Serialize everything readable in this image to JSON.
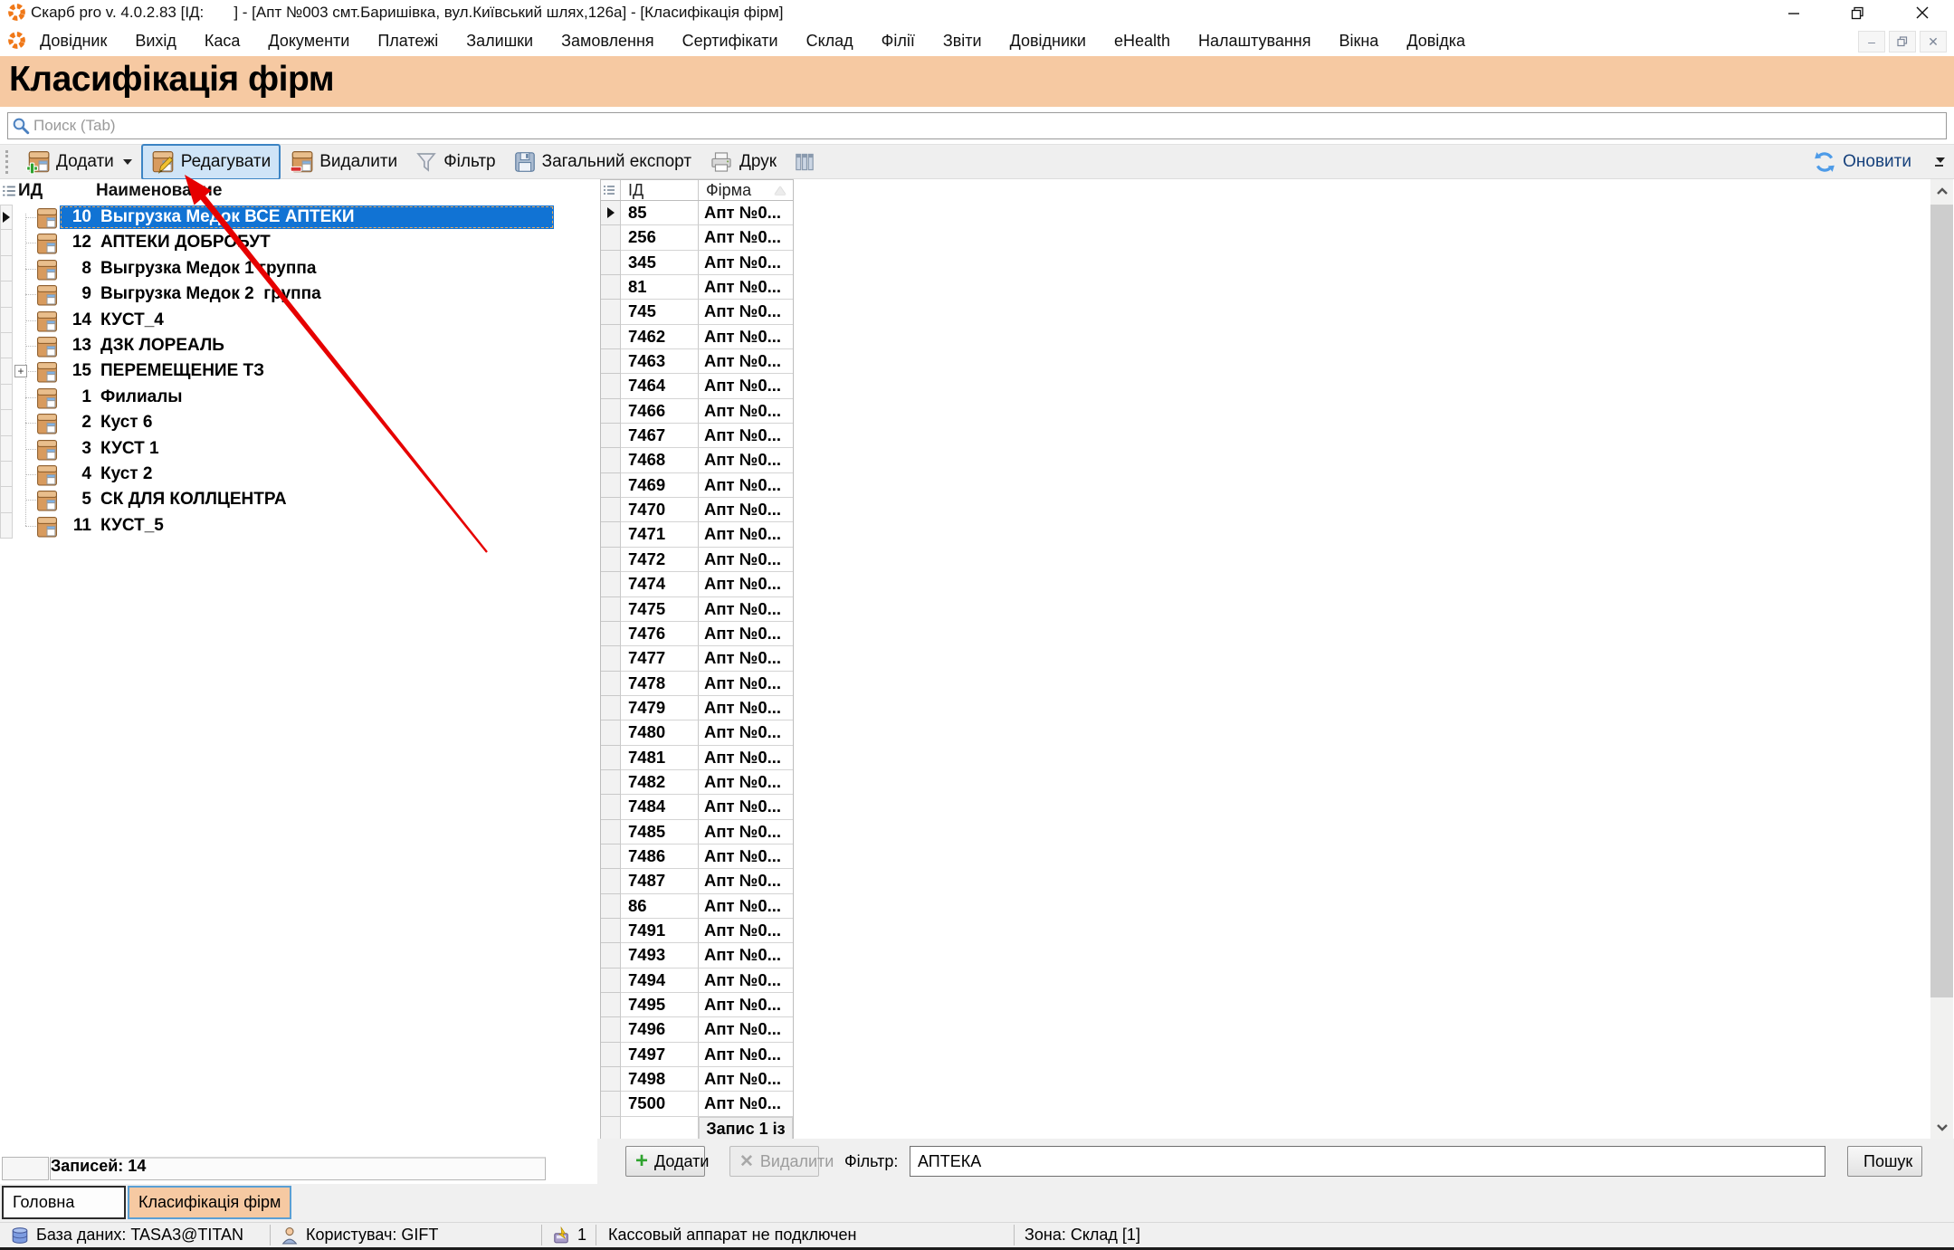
{
  "window": {
    "title": "Скарб pro v. 4.0.2.83 [ІД:       ] - [Апт №003 смт.Баришівка, вул.Київський шлях,126а] - [Класифікація фірм]",
    "controls": {
      "minimize": "minimize",
      "restore": "restore",
      "close": "close"
    }
  },
  "menu": {
    "items": [
      "Довідник",
      "Вихід",
      "Каса",
      "Документи",
      "Платежі",
      "Залишки",
      "Замовлення",
      "Сертифікати",
      "Склад",
      "Філії",
      "Звіти",
      "Довідники",
      "eHealth",
      "Налаштування",
      "Вікна",
      "Довідка"
    ]
  },
  "page": {
    "title": "Класифікація фірм"
  },
  "search": {
    "placeholder": "Поиск (Tab)"
  },
  "toolbar": {
    "add": "Додати",
    "edit": "Редагувати",
    "delete": "Видалити",
    "filter": "Фільтр",
    "export": "Загальний експорт",
    "print": "Друк",
    "refresh": "Оновити"
  },
  "tree": {
    "columns": {
      "id": "ИД",
      "name": "Наименование"
    },
    "items": [
      {
        "id": "10",
        "name": "Выгрузка Медок ВСЕ АПТЕКИ",
        "selected": true
      },
      {
        "id": "12",
        "name": "АПТЕКИ ДОБРОБУТ"
      },
      {
        "id": "8",
        "name": "Выгрузка Медок 1 группа"
      },
      {
        "id": "9",
        "name": "Выгрузка Медок 2  группа"
      },
      {
        "id": "14",
        "name": "КУСТ_4"
      },
      {
        "id": "13",
        "name": "ДЗК ЛОРЕАЛЬ"
      },
      {
        "id": "15",
        "name": "ПЕРЕМЕЩЕНИЕ ТЗ",
        "expandable": true
      },
      {
        "id": "1",
        "name": "Филиалы"
      },
      {
        "id": "2",
        "name": "Куст 6"
      },
      {
        "id": "3",
        "name": "КУСТ 1"
      },
      {
        "id": "4",
        "name": "Куст 2"
      },
      {
        "id": "5",
        "name": "СК ДЛЯ КОЛЛЦЕНТРА"
      },
      {
        "id": "11",
        "name": "КУСТ_5"
      }
    ],
    "records_label": "Записей: 14"
  },
  "table": {
    "columns": {
      "id": "ІД",
      "firm": "Фірма"
    },
    "firm_value": "Апт №0...",
    "ids": [
      "85",
      "256",
      "345",
      "81",
      "745",
      "7462",
      "7463",
      "7464",
      "7466",
      "7467",
      "7468",
      "7469",
      "7470",
      "7471",
      "7472",
      "7474",
      "7475",
      "7476",
      "7477",
      "7478",
      "7479",
      "7480",
      "7481",
      "7482",
      "7484",
      "7485",
      "7486",
      "7487",
      "86",
      "7491",
      "7493",
      "7494",
      "7495",
      "7496",
      "7497",
      "7498",
      "7500"
    ],
    "footer": "Запис 1 із"
  },
  "bottom_form": {
    "add": "Додати",
    "delete": "Видалити",
    "filter_label": "Фільтр:",
    "filter_value": "АПТЕКА",
    "search": "Пошук"
  },
  "tabs": [
    {
      "label": "Головна",
      "active": false
    },
    {
      "label": "Класифікація фірм",
      "active": true
    }
  ],
  "statusbar": {
    "database": "База даних: TASA3@TITAN",
    "user": "Користувач: GIFT",
    "cash_count": "1",
    "cash_status": "Кассовый аппарат не подключен",
    "zone": "Зона: Склад [1]"
  },
  "colors": {
    "header_peach": "#f6c9a2",
    "selection_blue": "#1173d4",
    "edit_highlight": "#cfe4f7",
    "arrow_red": "#e60000"
  }
}
